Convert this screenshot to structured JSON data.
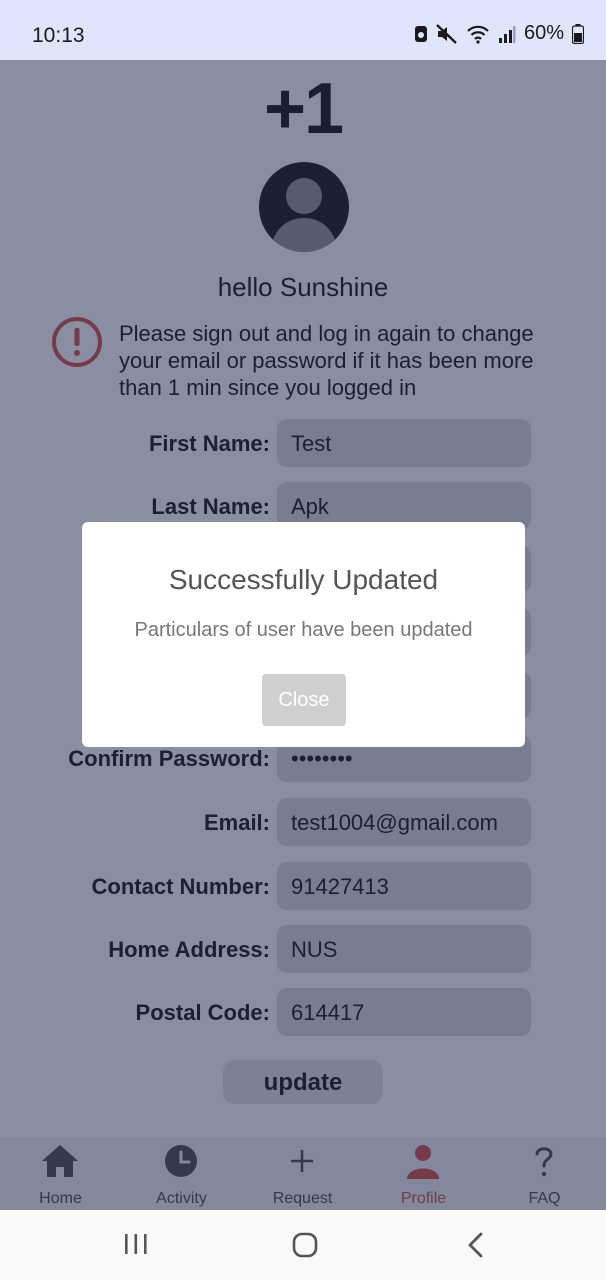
{
  "status_bar": {
    "time": "10:13",
    "battery": "60%",
    "icons": [
      "notification-icon",
      "mute-icon",
      "wifi-icon",
      "signal-icon",
      "battery-icon"
    ]
  },
  "header": {
    "logo": "+1",
    "greeting": "hello Sunshine"
  },
  "notice": {
    "text": "Please sign out and log in again to change your email or password if it has been more than 1 min since you logged in",
    "icon": "exclamation-circle-icon",
    "icon_color": "#d8584a"
  },
  "form": {
    "fields": [
      {
        "label": "First Name:",
        "value": "Test"
      },
      {
        "label": "Last Name:",
        "value": "Apk"
      },
      {
        "label": "Confirm Password:",
        "value": "••••••••"
      },
      {
        "label": "Email:",
        "value": "test1004@gmail.com"
      },
      {
        "label": "Contact Number:",
        "value": "91427413"
      },
      {
        "label": "Home Address:",
        "value": "NUS"
      },
      {
        "label": "Postal Code:",
        "value": "614417"
      }
    ],
    "submit_label": "update"
  },
  "bottom_nav": {
    "items": [
      {
        "label": "Home",
        "icon": "home-icon"
      },
      {
        "label": "Activity",
        "icon": "clock-icon"
      },
      {
        "label": "Request",
        "icon": "plus-icon"
      },
      {
        "label": "Profile",
        "icon": "person-icon",
        "active": true
      },
      {
        "label": "FAQ",
        "icon": "question-icon"
      }
    ],
    "active_color": "#d8584a"
  },
  "dialog": {
    "title": "Successfully Updated",
    "message": "Particulars of user have been updated",
    "close_label": "Close"
  },
  "system_nav": {
    "icons": [
      "recents-icon",
      "home-circle-icon",
      "back-icon"
    ]
  }
}
